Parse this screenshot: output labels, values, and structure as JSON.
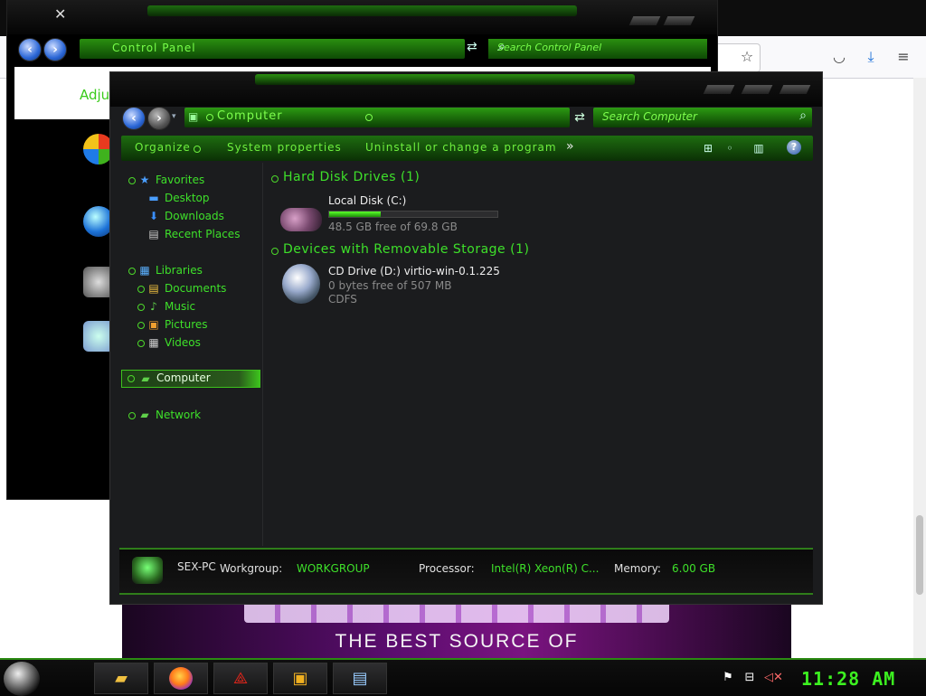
{
  "colors": {
    "accent_green": "#3ee02a",
    "panel_dark": "#1b1c1e"
  },
  "control_panel": {
    "address": "Control Panel",
    "search_placeholder": "Search Control Panel",
    "partial_heading": "Adjus"
  },
  "explorer": {
    "address": "Computer",
    "search_placeholder": "Search Computer",
    "toolbar": {
      "organize": "Organize",
      "system_properties": "System properties",
      "uninstall": "Uninstall or change a program",
      "more": "»",
      "help": "?"
    },
    "nav": {
      "favorites": "Favorites",
      "desktop": "Desktop",
      "downloads": "Downloads",
      "recent_places": "Recent Places",
      "libraries": "Libraries",
      "documents": "Documents",
      "music": "Music",
      "pictures": "Pictures",
      "videos": "Videos",
      "computer": "Computer",
      "network": "Network"
    },
    "groups": {
      "hdd": "Hard Disk Drives (1)",
      "removable": "Devices with Removable Storage (1)"
    },
    "drives": {
      "c_name": "Local Disk (C:)",
      "c_free": "48.5 GB free of 69.8 GB",
      "c_used_fraction": 0.305,
      "d_name": "CD Drive (D:) virtio-win-0.1.225",
      "d_free": "0 bytes free of 507 MB",
      "d_fs": "CDFS"
    },
    "details": {
      "pc_name": "SEX-PC",
      "workgroup_label": "Workgroup:",
      "workgroup": "WORKGROUP",
      "processor_label": "Processor:",
      "processor": "Intel(R) Xeon(R) C...",
      "memory_label": "Memory:",
      "memory": "6.00 GB"
    }
  },
  "browser_banner": {
    "tagline": "THE BEST SOURCE OF"
  },
  "taskbar": {
    "clock": "11:28 AM"
  }
}
